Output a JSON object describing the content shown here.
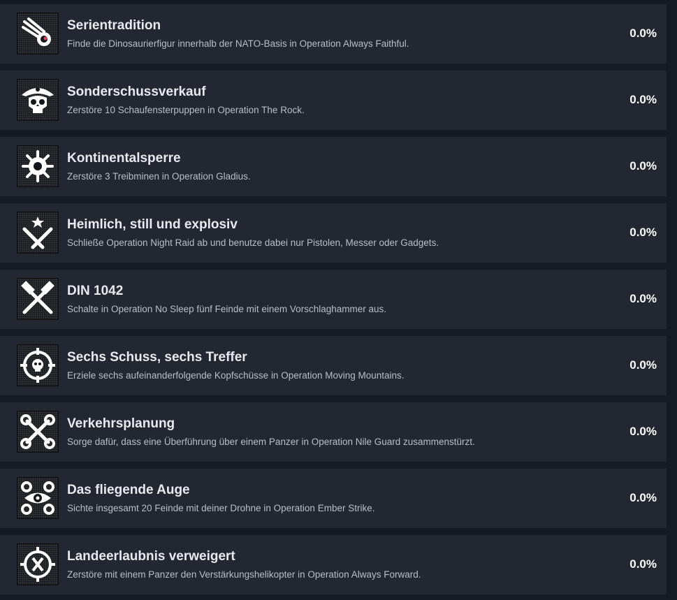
{
  "achievements": [
    {
      "title": "Serientradition",
      "description": "Finde die Dinosaurierfigur innerhalb der NATO-Basis in Operation Always Faithful.",
      "percent": "0.0%",
      "icon": "comet-icon"
    },
    {
      "title": "Sonderschussverkauf",
      "description": "Zerstöre 10 Schaufensterpuppen in Operation The Rock.",
      "percent": "0.0%",
      "icon": "pirate-skull-icon"
    },
    {
      "title": "Kontinentalsperre",
      "description": "Zerstöre 3 Treibminen in Operation Gladius.",
      "percent": "0.0%",
      "icon": "sea-mine-icon"
    },
    {
      "title": "Heimlich, still und explosiv",
      "description": "Schließe Operation Night Raid ab und benutze dabei nur Pistolen, Messer oder Gadgets.",
      "percent": "0.0%",
      "icon": "crossed-knives-star-icon"
    },
    {
      "title": "DIN 1042",
      "description": "Schalte in Operation No Sleep fünf Feinde mit einem Vorschlaghammer aus.",
      "percent": "0.0%",
      "icon": "crossed-hammers-icon"
    },
    {
      "title": "Sechs Schuss, sechs Treffer",
      "description": "Erziele sechs aufeinanderfolgende Kopfschüsse in Operation Moving Mountains.",
      "percent": "0.0%",
      "icon": "crosshair-skull-icon"
    },
    {
      "title": "Verkehrsplanung",
      "description": "Sorge dafür, dass eine Überführung über einem Panzer in Operation Nile Guard zusammenstürzt.",
      "percent": "0.0%",
      "icon": "crossed-wrenches-icon"
    },
    {
      "title": "Das fliegende Auge",
      "description": "Sichte insgesamt 20 Feinde mit deiner Drohne in Operation Ember Strike.",
      "percent": "0.0%",
      "icon": "drone-eye-icon"
    },
    {
      "title": "Landeerlaubnis verweigert",
      "description": "Zerstöre mit einem Panzer den Verstärkungshelikopter in Operation Always Forward.",
      "percent": "0.0%",
      "icon": "helipad-target-icon"
    }
  ]
}
